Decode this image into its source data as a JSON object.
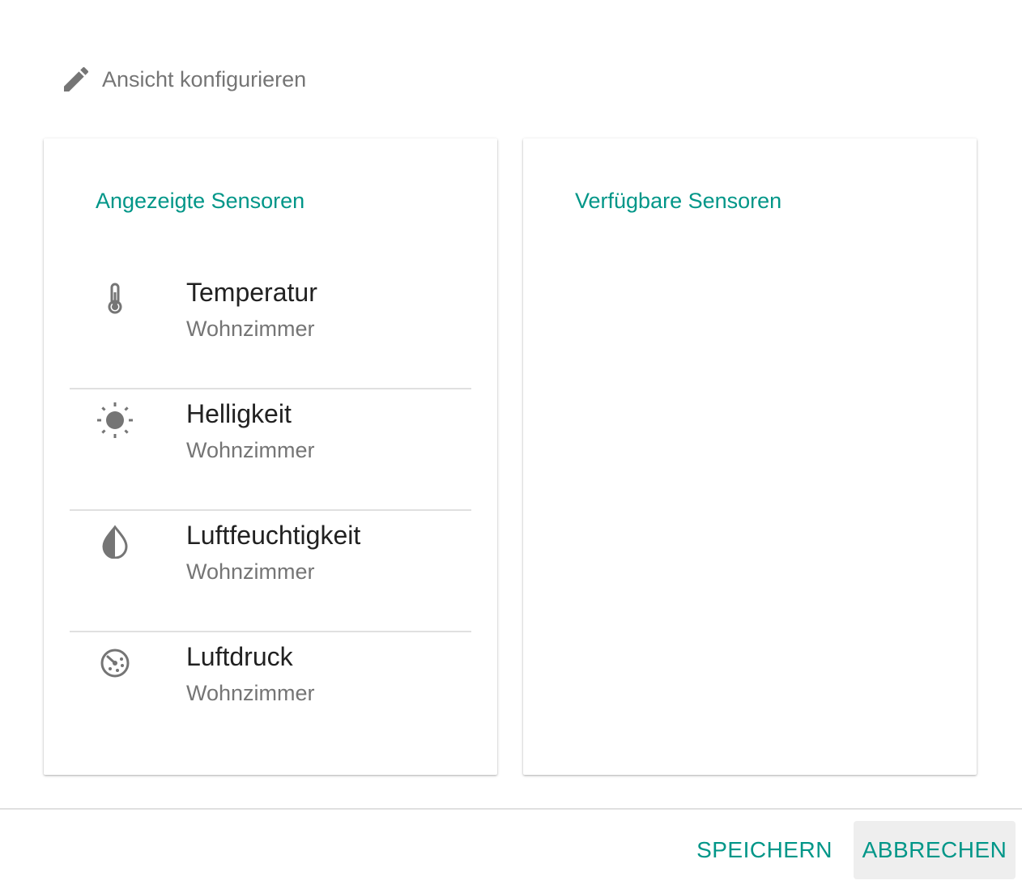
{
  "header": {
    "icon": "pencil-icon",
    "title": "Ansicht konfigurieren"
  },
  "panels": {
    "displayed": {
      "title": "Angezeigte Sensoren",
      "items": [
        {
          "name": "Temperatur",
          "room": "Wohnzimmer",
          "icon": "thermometer-icon"
        },
        {
          "name": "Helligkeit",
          "room": "Wohnzimmer",
          "icon": "brightness-icon"
        },
        {
          "name": "Luftfeuchtigkeit",
          "room": "Wohnzimmer",
          "icon": "humidity-drop-icon"
        },
        {
          "name": "Luftdruck",
          "room": "Wohnzimmer",
          "icon": "gauge-icon"
        }
      ]
    },
    "available": {
      "title": "Verfügbare Sensoren",
      "items": []
    }
  },
  "footer": {
    "save_label": "SPEICHERN",
    "cancel_label": "ABBRECHEN"
  },
  "colors": {
    "accent": "#009688",
    "icon": "#757575",
    "text_primary": "#212121",
    "text_secondary": "#757575",
    "divider": "#e0e0e0",
    "cancel_bg": "#eeeeee"
  }
}
